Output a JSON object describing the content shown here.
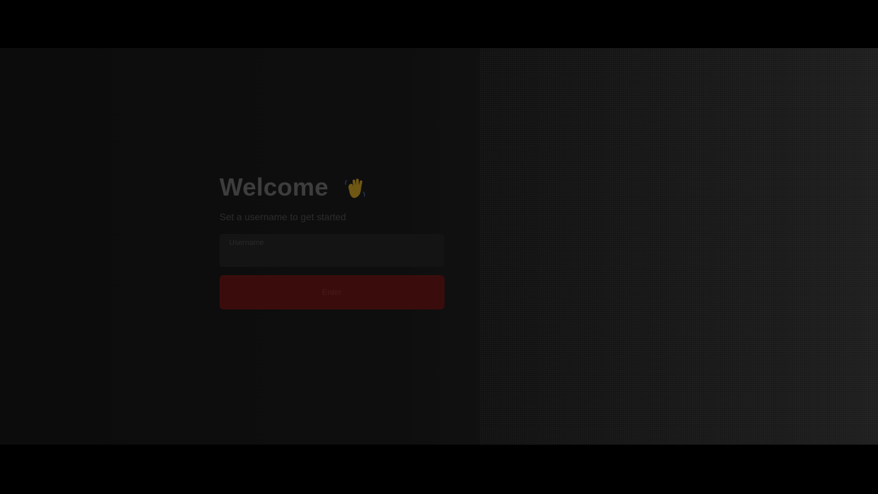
{
  "welcome": {
    "title": "Welcome",
    "wave_icon": "waving-hand-icon",
    "subtitle": "Set a username to get started"
  },
  "form": {
    "username_label": "Username",
    "username_value": "",
    "submit_label": "Enter"
  },
  "colors": {
    "accent": "#3a0d0c",
    "background": "#0e0e0e",
    "field_background": "#141414"
  }
}
